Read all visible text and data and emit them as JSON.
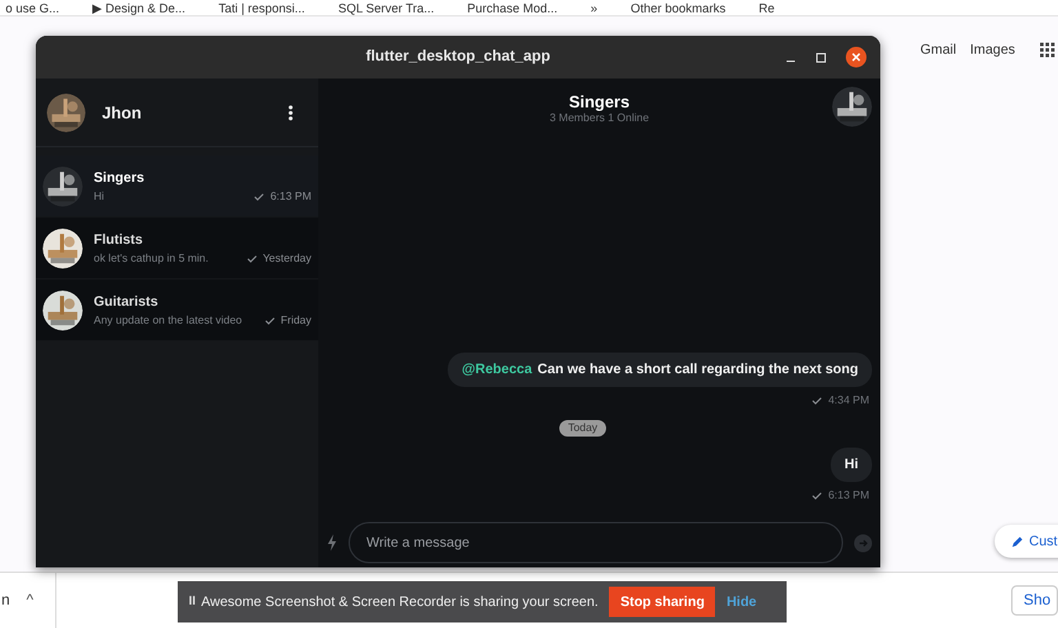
{
  "bookmarks": [
    "o use G...",
    "▶ Design & De...",
    "Tati | responsi...",
    "SQL Server Tra...",
    "Purchase Mod...",
    "»",
    "Other bookmarks",
    "Re"
  ],
  "browser_links": [
    "Gmail",
    "Images"
  ],
  "customize_button": "Cust",
  "window": {
    "title": "flutter_desktop_chat_app"
  },
  "profile": {
    "name": "Jhon"
  },
  "chats": [
    {
      "name": "Singers",
      "preview": "Hi",
      "time": "6:13 PM",
      "selected": true
    },
    {
      "name": "Flutists",
      "preview": "ok let's cathup in 5 min.",
      "time": "Yesterday",
      "selected": false
    },
    {
      "name": "Guitarists",
      "preview": "Any update on the latest video",
      "time": "Friday",
      "selected": false
    }
  ],
  "chat_header": {
    "title": "Singers",
    "subtitle": "3 Members 1 Online"
  },
  "messages": [
    {
      "kind": "message",
      "mention": "@Rebecca",
      "text": "Can we have a short call regarding the next song",
      "time": "4:34 PM"
    },
    {
      "kind": "date",
      "text": "Today"
    },
    {
      "kind": "message",
      "text": "Hi",
      "time": "6:13 PM"
    }
  ],
  "composer": {
    "placeholder": "Write a message"
  },
  "download_bar": {
    "left": "n",
    "caret": "^",
    "right": "Sho"
  },
  "share_bar": {
    "pause": "II",
    "text": "Awesome Screenshot & Screen Recorder is sharing your screen.",
    "stop": "Stop sharing",
    "hide": "Hide"
  }
}
